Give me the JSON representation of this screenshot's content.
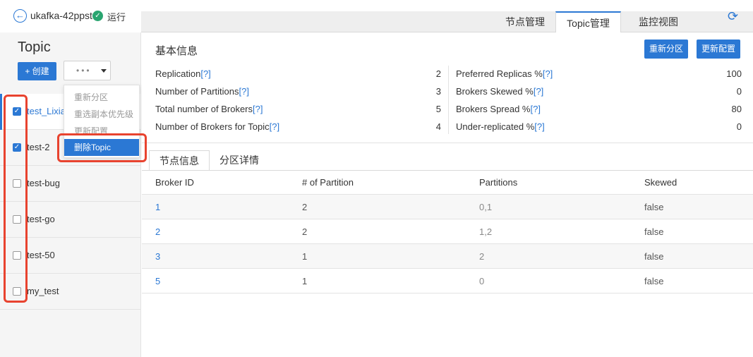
{
  "header": {
    "back_icon": "back-arrow-icon",
    "cluster_name": "ukafka-42ppst",
    "status_icon": "check-circle-icon",
    "status_text": "运行",
    "tabs": [
      {
        "label": "节点管理",
        "active": false
      },
      {
        "label": "Topic管理",
        "active": true
      },
      {
        "label": "监控视图",
        "active": false
      }
    ],
    "refresh_icon": "refresh-icon"
  },
  "sidebar": {
    "title": "Topic",
    "create_label": "+ 创建",
    "more_label": "•••",
    "topics": [
      {
        "name": "test_Lixia",
        "checked": true,
        "active": true
      },
      {
        "name": "test-2",
        "checked": true,
        "active": false
      },
      {
        "name": "test-bug",
        "checked": false,
        "active": false
      },
      {
        "name": "test-go",
        "checked": false,
        "active": false
      },
      {
        "name": "test-50",
        "checked": false,
        "active": false
      },
      {
        "name": "my_test",
        "checked": false,
        "active": false
      }
    ]
  },
  "dropdown_menu": {
    "items": [
      {
        "label": "重新分区",
        "active": false
      },
      {
        "label": "重选副本优先级",
        "active": false
      },
      {
        "label": "更新配置",
        "active": false
      },
      {
        "label": "删除Topic",
        "active": true
      }
    ]
  },
  "main": {
    "section_title": "基本信息",
    "repartition_label": "重新分区",
    "update_config_label": "更新配置",
    "help_text": "[?]",
    "info_left": [
      {
        "label": "Replication",
        "value": "2"
      },
      {
        "label": "Number of Partitions",
        "value": "3"
      },
      {
        "label": "Total number of Brokers",
        "value": "5"
      },
      {
        "label": "Number of Brokers for Topic",
        "value": "4"
      }
    ],
    "info_right": [
      {
        "label": "Preferred Replicas %",
        "value": "100"
      },
      {
        "label": "Brokers Skewed %",
        "value": "0"
      },
      {
        "label": "Brokers Spread %",
        "value": "80"
      },
      {
        "label": "Under-replicated %",
        "value": "0"
      }
    ],
    "sub_tabs": [
      {
        "label": "节点信息",
        "active": true
      },
      {
        "label": "分区详情",
        "active": false
      }
    ],
    "table": {
      "columns": [
        "Broker ID",
        "# of Partition",
        "Partitions",
        "Skewed"
      ],
      "rows": [
        [
          "1",
          "2",
          "0,1",
          "false"
        ],
        [
          "2",
          "2",
          "1,2",
          "false"
        ],
        [
          "3",
          "1",
          "2",
          "false"
        ],
        [
          "5",
          "1",
          "0",
          "false"
        ]
      ]
    }
  },
  "colors": {
    "accent": "#2b78d4",
    "highlight_red": "#e8432f",
    "status_green": "#2aa570"
  }
}
